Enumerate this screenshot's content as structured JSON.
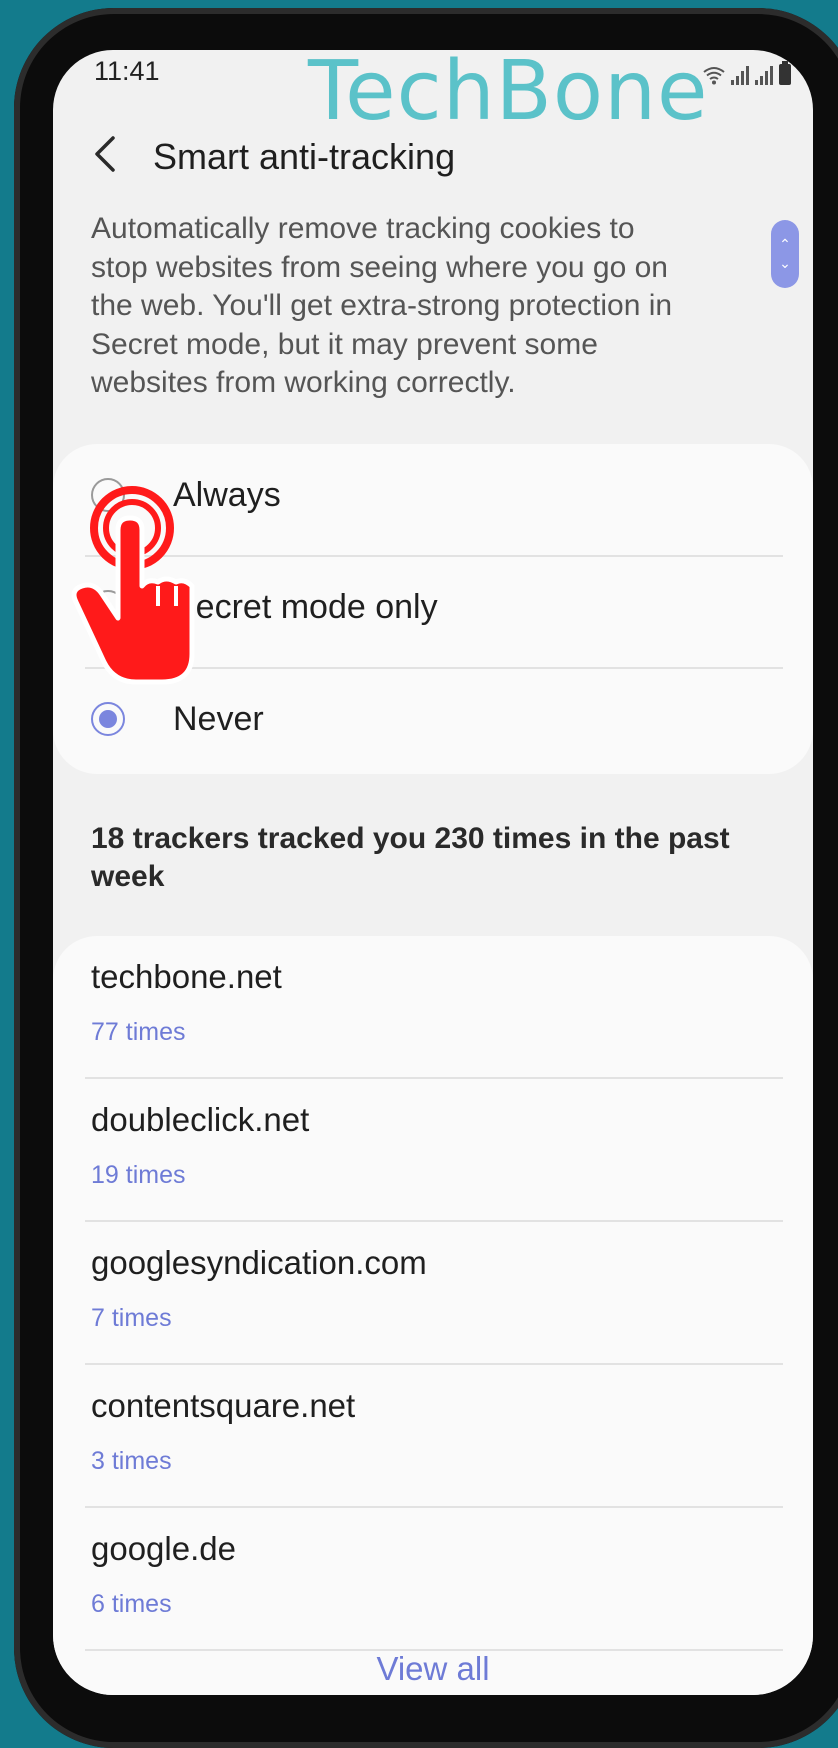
{
  "status_bar": {
    "time": "11:41"
  },
  "watermark": "TechBone",
  "header": {
    "title": "Smart anti-tracking"
  },
  "description": "Automatically remove tracking cookies to stop websites from seeing where you go on the web. You'll get extra-strong protection in Secret mode, but it may prevent some websites from working correctly.",
  "options": [
    {
      "label": "Always",
      "selected": false
    },
    {
      "label": "Secret mode only",
      "selected": false
    },
    {
      "label": "Never",
      "selected": true
    }
  ],
  "summary": "18 trackers tracked you 230 times in the past week",
  "trackers": [
    {
      "domain": "techbone.net",
      "count": "77 times"
    },
    {
      "domain": "doubleclick.net",
      "count": "19 times"
    },
    {
      "domain": "googlesyndication.com",
      "count": "7 times"
    },
    {
      "domain": "contentsquare.net",
      "count": "3 times"
    },
    {
      "domain": "google.de",
      "count": "6 times"
    }
  ],
  "view_all": "View all",
  "colors": {
    "accent": "#7b86de",
    "background": "#137b8c",
    "tap_indicator": "#ff1a1a"
  }
}
